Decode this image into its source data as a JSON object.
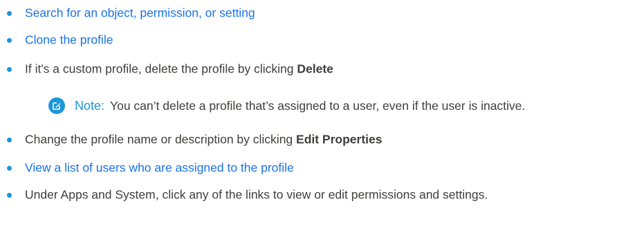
{
  "bullets": [
    {
      "text": "Search for an object, permission, or setting",
      "link": true
    },
    {
      "text": "Clone the profile",
      "link": true
    },
    {
      "prefix": "If it's a custom profile, delete the profile by clicking ",
      "bold": "Delete"
    },
    {
      "prefix": "Change the profile name or description by clicking ",
      "bold": "Edit Properties"
    },
    {
      "text": "View a list of users who are assigned to the profile",
      "link": true
    },
    {
      "text": "Under Apps and System, click any of the links to view or edit permissions and settings."
    }
  ],
  "note": {
    "label": "Note:",
    "text": "You can’t delete a profile that’s assigned to a user, even if the user is inactive.",
    "icon": "edit-note-icon"
  },
  "colors": {
    "link": "#1a73e8",
    "bullet": "#1b96d8",
    "note_accent": "#1b96d8",
    "text": "#3e3e3c"
  }
}
